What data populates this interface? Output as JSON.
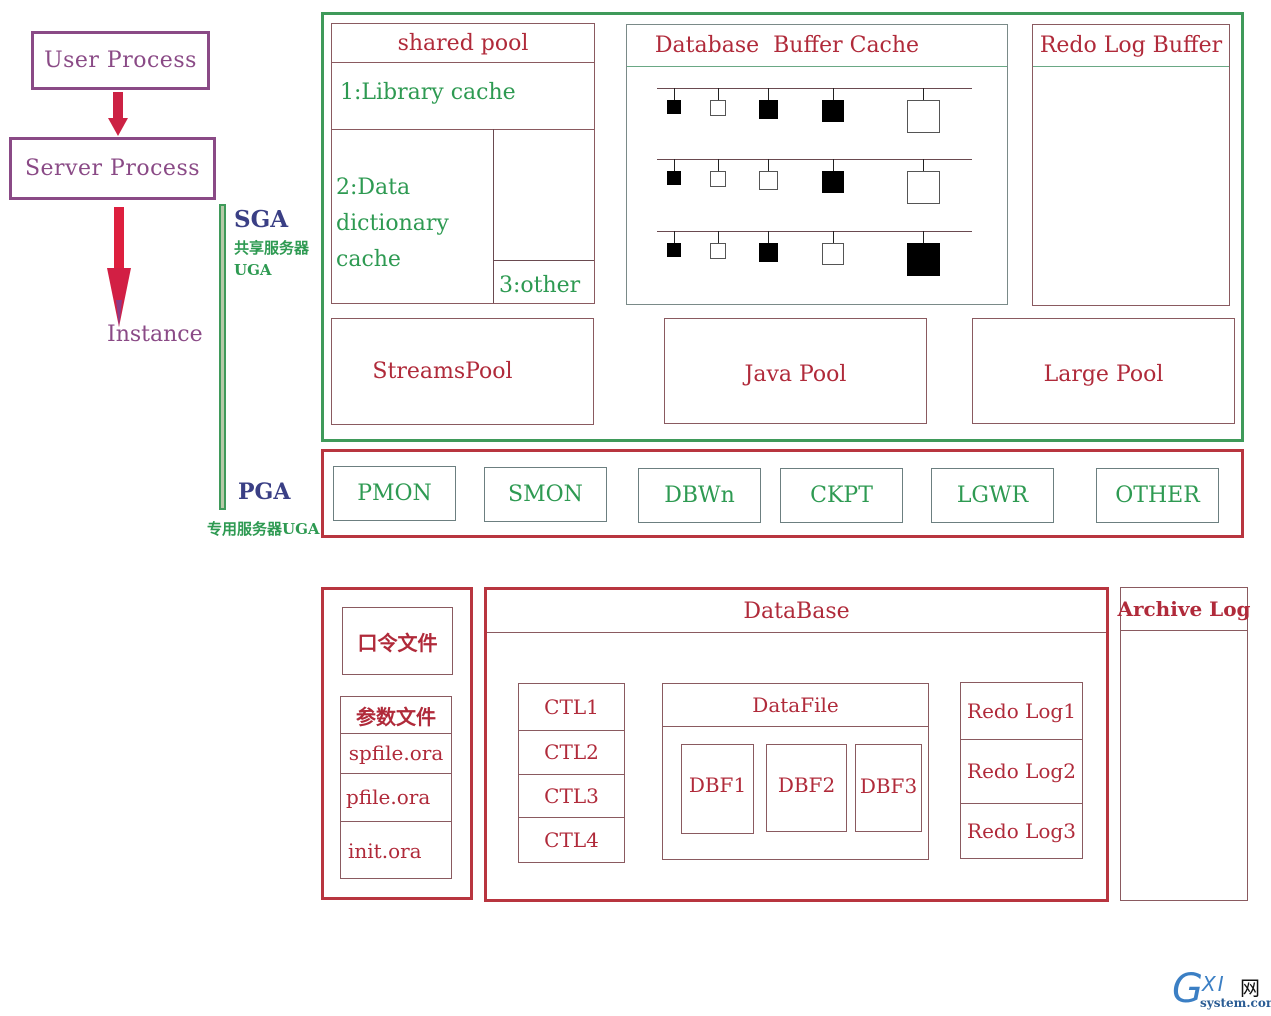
{
  "left_column": {
    "user_process": "User Process",
    "server_process": "Server Process",
    "instance": "Instance",
    "sga_label": "SGA",
    "sga_note_line1": "共享服务器",
    "sga_note_line2": "UGA",
    "pga_label": "PGA",
    "pga_note": "专用服务器UGA"
  },
  "sga": {
    "shared_pool": {
      "title": "shared pool",
      "library_cache": "1:Library cache",
      "data_dictionary_line1": "2:Data",
      "data_dictionary_line2": "dictionary",
      "data_dictionary_line3": "cache",
      "other": "3:other"
    },
    "buffer_cache": {
      "title": "Database  Buffer Cache",
      "rows": [
        {
          "blocks": [
            "filled",
            "empty",
            "filled",
            "filled",
            "empty"
          ]
        },
        {
          "blocks": [
            "filled",
            "empty",
            "empty",
            "filled",
            "empty"
          ]
        },
        {
          "blocks": [
            "filled",
            "empty",
            "filled",
            "empty",
            "filled"
          ]
        }
      ]
    },
    "redo_log_buffer": {
      "title": "Redo Log Buffer"
    },
    "streams_pool": "StreamsPool",
    "java_pool": "Java Pool",
    "large_pool": "Large Pool"
  },
  "background_processes": [
    "PMON",
    "SMON",
    "DBWn",
    "CKPT",
    "LGWR",
    "OTHER"
  ],
  "files": {
    "password_file": "口令文件",
    "param_file_title": "参数文件",
    "param_files": [
      "spfile.ora",
      "pfile.ora",
      "init.ora"
    ]
  },
  "database": {
    "title": "DataBase",
    "control_files": [
      "CTL1",
      "CTL2",
      "CTL3",
      "CTL4"
    ],
    "datafile_title": "DataFile",
    "datafiles": [
      "DBF1",
      "DBF2",
      "DBF3"
    ],
    "redo_logs": [
      "Redo Log1",
      "Redo Log2",
      "Redo Log3"
    ]
  },
  "archive_log": {
    "title": "Archive Log"
  },
  "watermark": {
    "logo_letters": "GXI",
    "logo_cn": "网",
    "domain": "system.com"
  }
}
